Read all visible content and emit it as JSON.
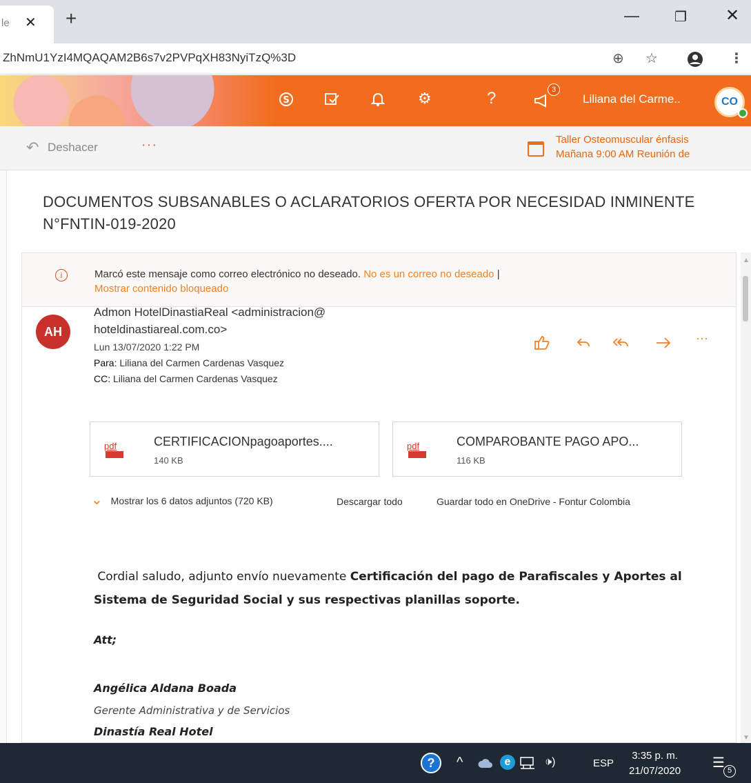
{
  "browser": {
    "tab_title": "le",
    "tab_close": "✕",
    "new_tab": "+",
    "url": "ZhNmU1YzI4MQAQAM2B6s7v2PVPqXH83NyiTzQ%3D",
    "window_controls": {
      "minimize": "—",
      "maximize": "❐",
      "close": "✕"
    }
  },
  "header": {
    "user_name": "Liliana del Carme..",
    "notification_count": "3",
    "avatar_initials": "CO",
    "accent_color": "#f26c1d",
    "icons": [
      "skype-icon",
      "todo-icon",
      "bell-icon",
      "gear-icon",
      "help-icon",
      "megaphone-icon"
    ]
  },
  "commands": {
    "undo_label": "Deshacer",
    "more": "···",
    "reminder_title": "Taller Osteomuscular énfasis",
    "reminder_detail": "Mañana 9:00 AM Reunión de"
  },
  "message": {
    "subject": "DOCUMENTOS SUBSANABLES O ACLARATORIOS OFERTA POR NECESIDAD INMINENTE N°FNTIN-019-2020",
    "junk_notice": "Marcó este mensaje como correo electrónico no deseado.",
    "not_junk_link": "No es un correo no deseado",
    "separator": "|",
    "show_blocked_link": "Mostrar contenido bloqueado",
    "sender_initials": "AH",
    "sender_line1": "Admon HotelDinastiaReal <administracion@",
    "sender_line2": "hoteldinastiareal.com.co>",
    "date": "Lun 13/07/2020 1:22 PM",
    "to_label": "Para:",
    "to_value": "Liliana del Carmen Cardenas Vasquez",
    "cc_label": "CC:",
    "cc_value": "Liliana del Carmen Cardenas Vasquez",
    "attachments": [
      {
        "name": "CERTIFICACIONpagoaportes....",
        "size": "140 KB",
        "icon": "pdf"
      },
      {
        "name": "COMPAROBANTE PAGO APO...",
        "size": "116 KB",
        "icon": "pdf"
      }
    ],
    "show_all_attachments": "Mostrar los 6 datos adjuntos (720 KB)",
    "download_all": "Descargar todo",
    "save_onedrive": "Guardar todo en OneDrive - Fontur Colombia",
    "body_intro": " Cordial saludo, adjunto envío nuevamente ",
    "body_bold": "Certificación del pago de Parafiscales y Aportes al Sistema de Seguridad Social y sus respectivas planillas soporte.",
    "sig_att": "Att;",
    "sig_name": "Angélica Aldana Boada",
    "sig_title": "Gerente Administrativa y de Servicios",
    "sig_company": "Dinastía Real Hotel"
  },
  "taskbar": {
    "language": "ESP",
    "time": "3:35 p. m.",
    "date": "21/07/2020",
    "notification_count": "5"
  }
}
